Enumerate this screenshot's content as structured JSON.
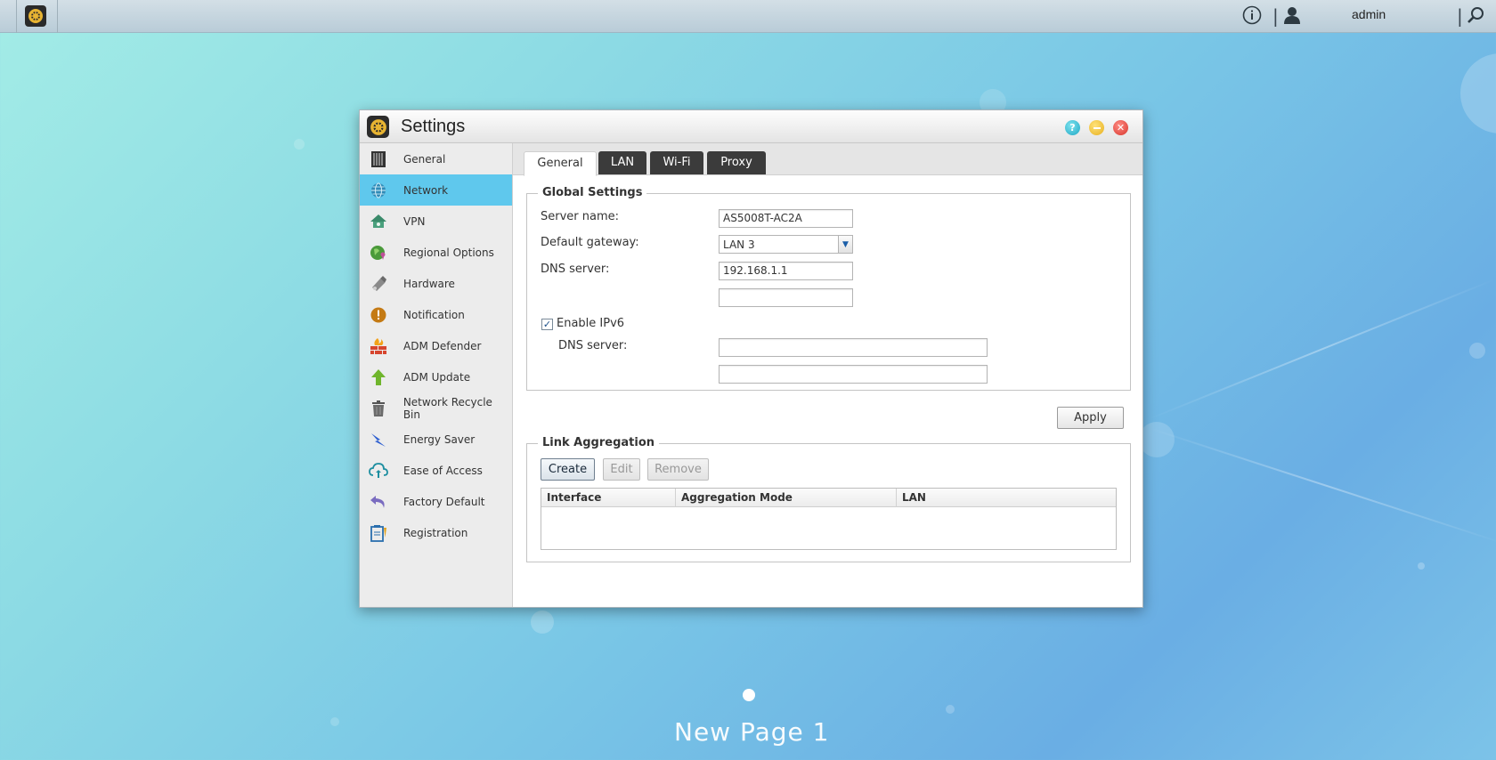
{
  "topbar": {
    "user_label": "admin",
    "icons": [
      "home-icon",
      "info-icon",
      "user-icon",
      "search-icon"
    ]
  },
  "window": {
    "title": "Settings",
    "controls": [
      "help-icon",
      "minimize-icon",
      "close-icon"
    ]
  },
  "sidebar": {
    "items": [
      {
        "label": "General",
        "icon": "server-icon",
        "active": false
      },
      {
        "label": "Network",
        "icon": "globe-icon",
        "active": true
      },
      {
        "label": "VPN",
        "icon": "vpn-icon",
        "active": false
      },
      {
        "label": "Regional Options",
        "icon": "regional-icon",
        "active": false
      },
      {
        "label": "Hardware",
        "icon": "hardware-icon",
        "active": false
      },
      {
        "label": "Notification",
        "icon": "notification-icon",
        "active": false
      },
      {
        "label": "ADM Defender",
        "icon": "firewall-icon",
        "active": false
      },
      {
        "label": "ADM Update",
        "icon": "update-icon",
        "active": false
      },
      {
        "label": "Network Recycle Bin",
        "icon": "trash-icon",
        "active": false
      },
      {
        "label": "Energy Saver",
        "icon": "energy-icon",
        "active": false
      },
      {
        "label": "Ease of Access",
        "icon": "cloud-icon",
        "active": false
      },
      {
        "label": "Factory Default",
        "icon": "reset-icon",
        "active": false
      },
      {
        "label": "Registration",
        "icon": "registration-icon",
        "active": false
      }
    ]
  },
  "tabs": [
    {
      "label": "General",
      "active": true
    },
    {
      "label": "LAN",
      "active": false
    },
    {
      "label": "Wi-Fi",
      "active": false
    },
    {
      "label": "Proxy",
      "active": false
    }
  ],
  "global_settings": {
    "legend": "Global Settings",
    "server_name_label": "Server name:",
    "server_name_value": "AS5008T-AC2A",
    "gateway_label": "Default gateway:",
    "gateway_value": "LAN 3",
    "dns_label": "DNS server:",
    "dns_primary": "192.168.1.1",
    "dns_secondary": "",
    "ipv6_label": "Enable IPv6",
    "ipv6_checked": true,
    "ipv6_dns_label": "DNS server:",
    "ipv6_dns_primary": "",
    "ipv6_dns_secondary": ""
  },
  "apply_label": "Apply",
  "link_aggregation": {
    "legend": "Link Aggregation",
    "create_label": "Create",
    "edit_label": "Edit",
    "remove_label": "Remove",
    "columns": [
      "Interface",
      "Aggregation Mode",
      "LAN"
    ],
    "rows": []
  },
  "desktop": {
    "page_label": "New Page 1"
  },
  "colors": {
    "active_sidebar": "#5fc8ed",
    "tab_dark": "#3b3b3b"
  }
}
